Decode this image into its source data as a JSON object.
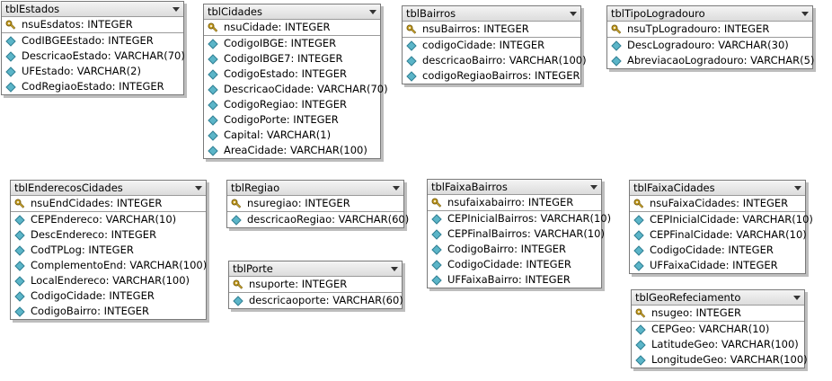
{
  "tables": [
    {
      "id": "tblEstados",
      "name": "tblEstados",
      "pk": "nsuEsdatos: INTEGER",
      "columns": [
        "CodIBGEEstado: INTEGER",
        "DescricaoEstado: VARCHAR(70)",
        "UFEstado: VARCHAR(2)",
        "CodRegiaoEstado: INTEGER"
      ]
    },
    {
      "id": "tblCidades",
      "name": "tblCidades",
      "pk": "nsuCidade: INTEGER",
      "columns": [
        "CodigoIBGE: INTEGER",
        "CodigoIBGE7: INTEGER",
        "CodigoEstado: INTEGER",
        "DescricaoCidade: VARCHAR(70)",
        "CodigoRegiao: INTEGER",
        "CodigoPorte: INTEGER",
        "Capital: VARCHAR(1)",
        "AreaCidade: VARCHAR(100)"
      ]
    },
    {
      "id": "tblBairros",
      "name": "tblBairros",
      "pk": "nsuBairros: INTEGER",
      "columns": [
        "codigoCidade: INTEGER",
        "descricaoBairro: VARCHAR(100)",
        "codigoRegiaoBairros: INTEGER"
      ]
    },
    {
      "id": "tblTipoLogradouro",
      "name": "tblTipoLogradouro",
      "pk": "nsuTpLogradouro: INTEGER",
      "columns": [
        "DescLogradouro: VARCHAR(30)",
        "AbreviacaoLogradouro: VARCHAR(5)"
      ]
    },
    {
      "id": "tblEnderecosCidades",
      "name": "tblEnderecosCidades",
      "pk": "nsuEndCidades: INTEGER",
      "columns": [
        "CEPEndereco: VARCHAR(10)",
        "DescEndereco: INTEGER",
        "CodTPLog: INTEGER",
        "ComplementoEnd: VARCHAR(100)",
        "LocalEndereco: VARCHAR(100)",
        "CodigoCidade: INTEGER",
        "CodigoBairro: INTEGER"
      ]
    },
    {
      "id": "tblRegiao",
      "name": "tblRegiao",
      "pk": "nsuregiao: INTEGER",
      "columns": [
        "descricaoRegiao: VARCHAR(60)"
      ]
    },
    {
      "id": "tblPorte",
      "name": "tblPorte",
      "pk": "nsuporte: INTEGER",
      "columns": [
        "descricaoporte: VARCHAR(60)"
      ]
    },
    {
      "id": "tblFaixaBairros",
      "name": "tblFaixaBairros",
      "pk": "nsufaixabairro: INTEGER",
      "columns": [
        "CEPInicialBairros: VARCHAR(10)",
        "CEPFinalBairros: VARCHAR(10)",
        "CodigoBairro: INTEGER",
        "CodigoCidade: INTEGER",
        "UFFaixaBairro: INTEGER"
      ]
    },
    {
      "id": "tblFaixaCidades",
      "name": "tblFaixaCidades",
      "pk": "nsuFaixaCidades: INTEGER",
      "columns": [
        "CEPInicialCidade: VARCHAR(10)",
        "CEPFinalCidade: VARCHAR(10)",
        "CodigoCidade: INTEGER",
        "UFFaixaCidade: INTEGER"
      ]
    },
    {
      "id": "tblGeoRefeciamento",
      "name": "tblGeoRefeciamento",
      "pk": "nsugeo: INTEGER",
      "columns": [
        "CEPGeo: VARCHAR(10)",
        "LatitudeGeo: VARCHAR(100)",
        "LongitudeGeo: VARCHAR(100)"
      ]
    }
  ],
  "icons": {
    "primary_key": "key-icon",
    "column": "diamond-icon",
    "dropdown": "dropdown-arrow-icon"
  },
  "colors": {
    "diamond_fill": "#5bb5c8",
    "diamond_stroke": "#2f7f93",
    "key_fill": "#c9a227"
  }
}
